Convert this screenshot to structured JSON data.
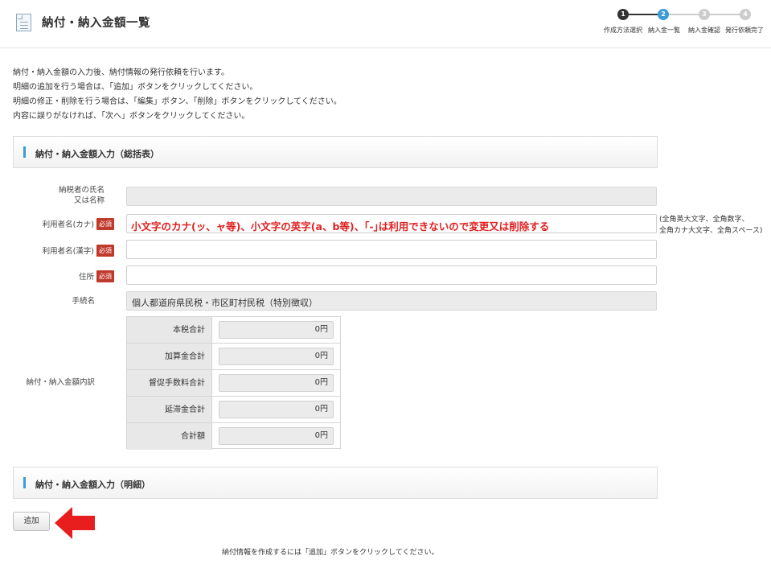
{
  "header": {
    "title": "納付・納入金額一覧",
    "icon": "document-icon",
    "steps": [
      {
        "number": "1",
        "label": "作成方法選択",
        "state": "done"
      },
      {
        "number": "2",
        "label": "納入金一覧",
        "state": "current"
      },
      {
        "number": "3",
        "label": "納入金確認",
        "state": "todo"
      },
      {
        "number": "4",
        "label": "発行依頼完了",
        "state": "todo"
      }
    ]
  },
  "intro": [
    "納付・納入金額の入力後、納付情報の発行依頼を行います。",
    "明細の追加を行う場合は、「追加」ボタンをクリックしてください。",
    "明細の修正・削除を行う場合は、「編集」ボタン、「削除」ボタンをクリックしてください。",
    "内容に誤りがなければ、「次へ」ボタンをクリックしてください。"
  ],
  "summary_section": {
    "heading": "納付・納入金額入力（総括表）",
    "taxpayer_label_line1": "納税者の氏名",
    "taxpayer_label_line2": "又は名称",
    "taxpayer_value": "",
    "user_kana_label": "利用者名(カナ)",
    "user_kana_value": "",
    "user_kana_annotation": "小文字のカナ(ッ、ャ等)、小文字の英字(a、b等)、｢-｣は利用できないので変更又は削除する",
    "user_kana_note_line1": "(全角英大文字、全角数字、",
    "user_kana_note_line2": "全角カナ大文字、全角スペース)",
    "user_kanji_label": "利用者名(漢字)",
    "user_kanji_value": "",
    "address_label": "住所",
    "address_value": "",
    "required_badge": "必須",
    "procedure_label": "手続名",
    "procedure_value": "個人都道府県民税・市区町村民税（特別徴収）",
    "breakdown_label": "納付・納入金額内訳",
    "breakdown": [
      {
        "label": "本税合計",
        "value": "0円"
      },
      {
        "label": "加算金合計",
        "value": "0円"
      },
      {
        "label": "督促手数料合計",
        "value": "0円"
      },
      {
        "label": "延滞金合計",
        "value": "0円"
      },
      {
        "label": "合計額",
        "value": "0円"
      }
    ]
  },
  "detail_section": {
    "heading": "納付・納入金額入力（明細）",
    "add_button": "追加",
    "footnote": "納付情報を作成するには「追加」ボタンをクリックしてください。"
  },
  "colors": {
    "accent": "#3d9bd6",
    "required": "#c0392b",
    "annotation": "#e02020",
    "step_done": "#333333",
    "step_current": "#3d9bd6",
    "step_todo": "#cccccc"
  }
}
